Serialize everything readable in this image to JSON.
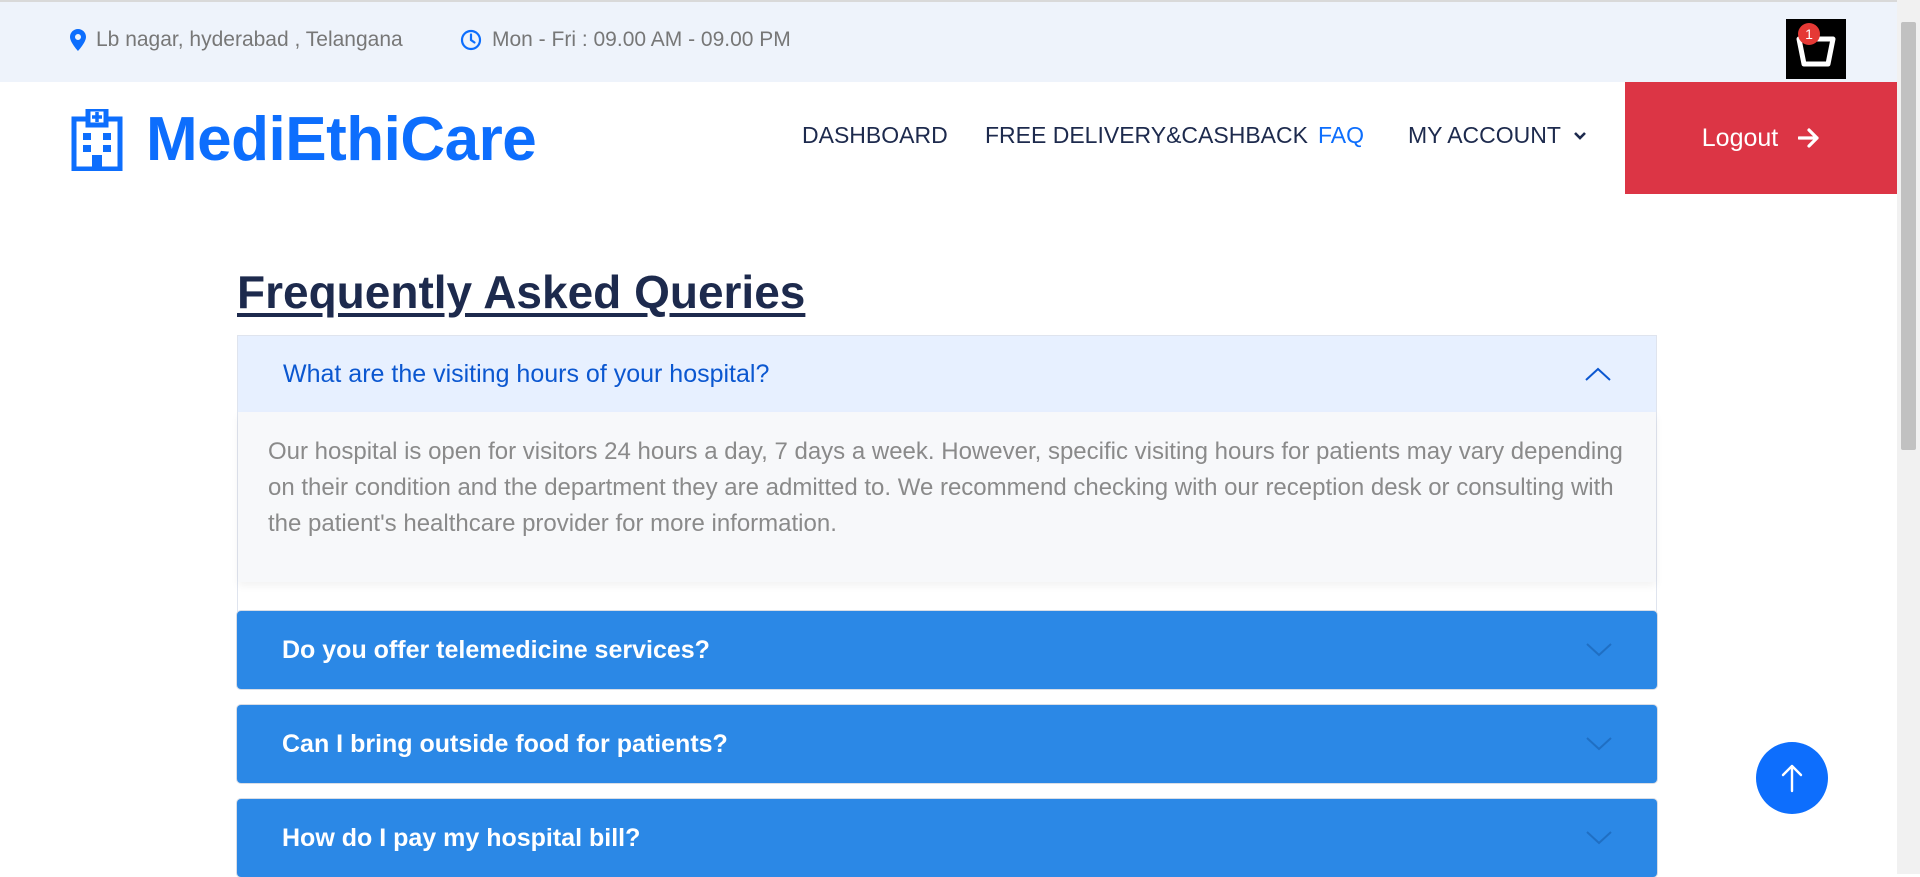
{
  "topbar": {
    "location": "Lb nagar, hyderabad , Telangana",
    "hours": "Mon - Fri : 09.00 AM - 09.00 PM",
    "cart_count": "1"
  },
  "brand": {
    "name": "MediEthiCare",
    "color": "#0d6efd"
  },
  "nav": {
    "items": [
      {
        "label": "DASHBOARD"
      },
      {
        "label": "FREE DELIVERY&CASHBACK"
      },
      {
        "label": "FAQ"
      },
      {
        "label": "MY ACCOUNT"
      }
    ],
    "logout_label": "Logout",
    "logout_color": "#dc3545"
  },
  "faq": {
    "title": "Frequently Asked Queries",
    "items": [
      {
        "question": "What are the visiting hours of your hospital?",
        "answer": "Our hospital is open for visitors 24 hours a day, 7 days a week. However, specific visiting hours for patients may vary depending on their condition and the department they are admitted to. We recommend checking with our reception desk or consulting with the patient's healthcare provider for more information.",
        "expanded": true
      },
      {
        "question": "Do you offer telemedicine services?",
        "expanded": false
      },
      {
        "question": "Can I bring outside food for patients?",
        "expanded": false
      },
      {
        "question": "How do I pay my hospital bill?",
        "expanded": false
      }
    ]
  },
  "icons": {
    "location": "map-pin-icon",
    "clock": "clock-icon",
    "cart": "shopping-basket-icon",
    "brand": "hospital-icon",
    "logout": "arrow-right-icon",
    "scroll_top": "arrow-up-icon"
  }
}
